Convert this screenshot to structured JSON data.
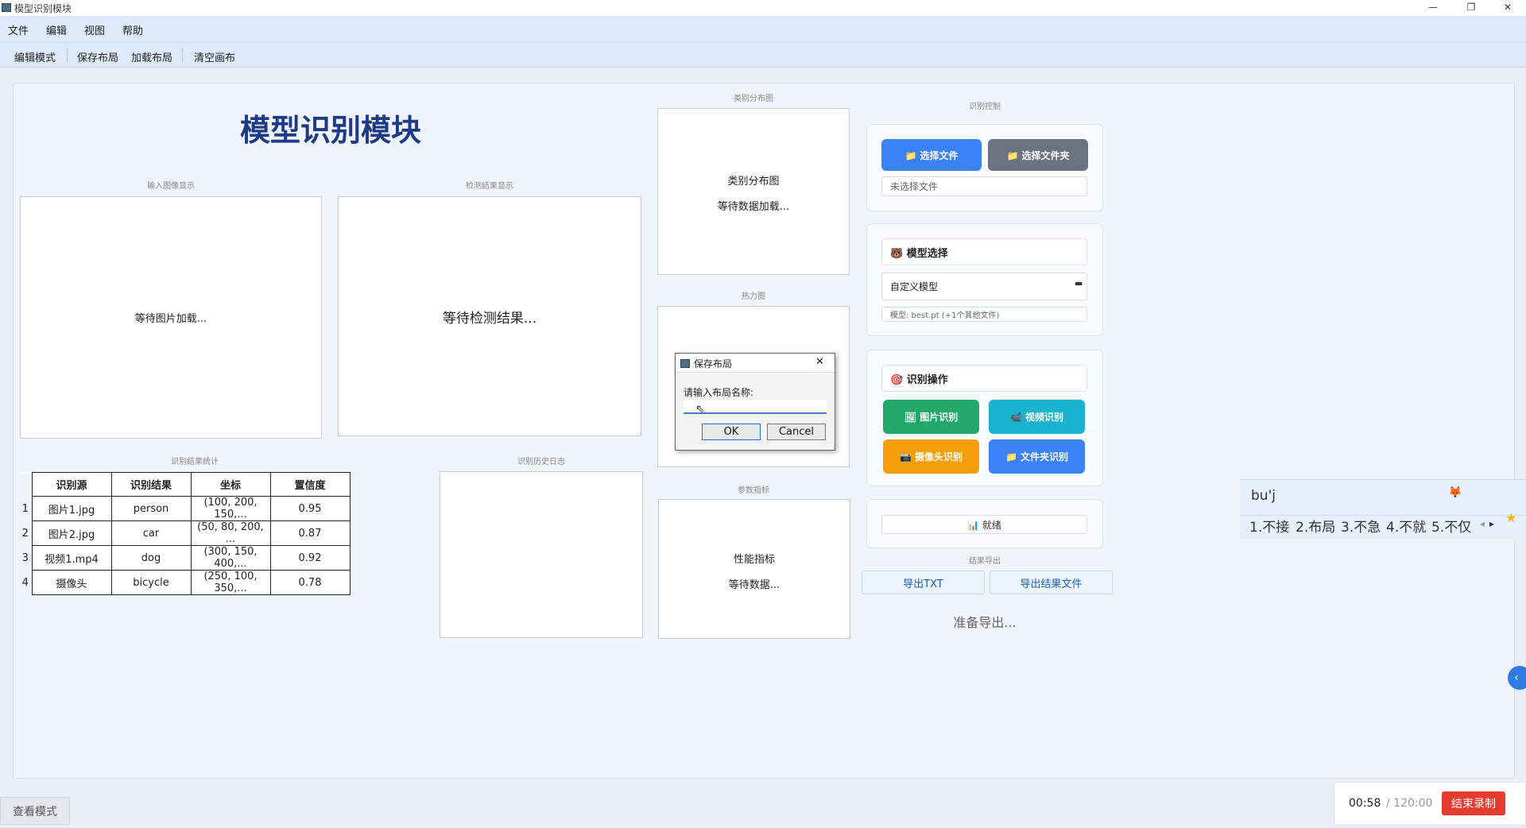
{
  "window": {
    "title": "模型识别模块",
    "minimize": "—",
    "restore": "❐",
    "close": "✕"
  },
  "menu": [
    "文件",
    "编辑",
    "视图",
    "帮助"
  ],
  "toolbar": [
    "编辑模式",
    "保存布局",
    "加载布局",
    "清空画布"
  ],
  "main": {
    "title": "模型识别模块",
    "input_image": {
      "caption": "输入图像显示",
      "placeholder": "等待图片加载..."
    },
    "detection_result": {
      "caption": "检测结果显示",
      "placeholder": "等待检测结果..."
    },
    "stats": {
      "caption": "识别结果统计",
      "columns": [
        "识别源",
        "识别结果",
        "坐标",
        "置信度"
      ],
      "rows": [
        {
          "num": "1",
          "source": "图片1.jpg",
          "result": "person",
          "coords": "(100, 200, 150,...",
          "conf": "0.95"
        },
        {
          "num": "2",
          "source": "图片2.jpg",
          "result": "car",
          "coords": "(50, 80, 200, ...",
          "conf": "0.87"
        },
        {
          "num": "3",
          "source": "视频1.mp4",
          "result": "dog",
          "coords": "(300, 150, 400,...",
          "conf": "0.92"
        },
        {
          "num": "4",
          "source": "摄像头",
          "result": "bicycle",
          "coords": "(250, 100, 350,...",
          "conf": "0.78"
        }
      ]
    },
    "history": {
      "caption": "识别历史日志"
    },
    "class_dist": {
      "caption": "类别分布图",
      "line1": "类别分布图",
      "line2": "等待数据加载..."
    },
    "heatmap": {
      "caption": "热力图"
    },
    "metrics": {
      "caption": "参数指标",
      "line1": "性能指标",
      "line2": "等待数据..."
    }
  },
  "control": {
    "caption": "识别控制",
    "select_file": "📁 选择文件",
    "select_folder": "📁 选择文件夹",
    "file_status": "未选择文件",
    "model_header": "🐻 模型选择",
    "model_value": "自定义模型",
    "model_info": "模型: best.pt (+1个其他文件)",
    "ops_header": "🎯 识别操作",
    "image_recog": "🖼 图片识别",
    "video_recog": "📹 视频识别",
    "camera_recog": "📷 摄像头识别",
    "folder_recog": "📁 文件夹识别",
    "status": "📊 就绪",
    "export_caption": "结果导出",
    "export_txt": "导出TXT",
    "export_file": "导出结果文件",
    "export_status": "准备导出..."
  },
  "dialog": {
    "title": "保存布局",
    "prompt": "请输入布局名称:",
    "input_value": "",
    "ok": "OK",
    "cancel": "Cancel",
    "close": "✕"
  },
  "ime": {
    "composition": "bu'j",
    "candidates": [
      "1.不接",
      "2.布局",
      "3.不急",
      "4.不就",
      "5.不仅"
    ]
  },
  "statusbar": {
    "mode": "查看模式",
    "time_elapsed": "00:58",
    "time_total": "/ 120:00",
    "stop_button": "结束录制"
  },
  "colors": {
    "blue_btn": "#3b82f6",
    "gray_btn": "#6b7280",
    "green_btn": "#22a86b",
    "cyan_btn": "#17b3cf",
    "orange_btn": "#f59e0b",
    "record_red": "#e63b2e",
    "title_navy": "#1f3b87"
  }
}
